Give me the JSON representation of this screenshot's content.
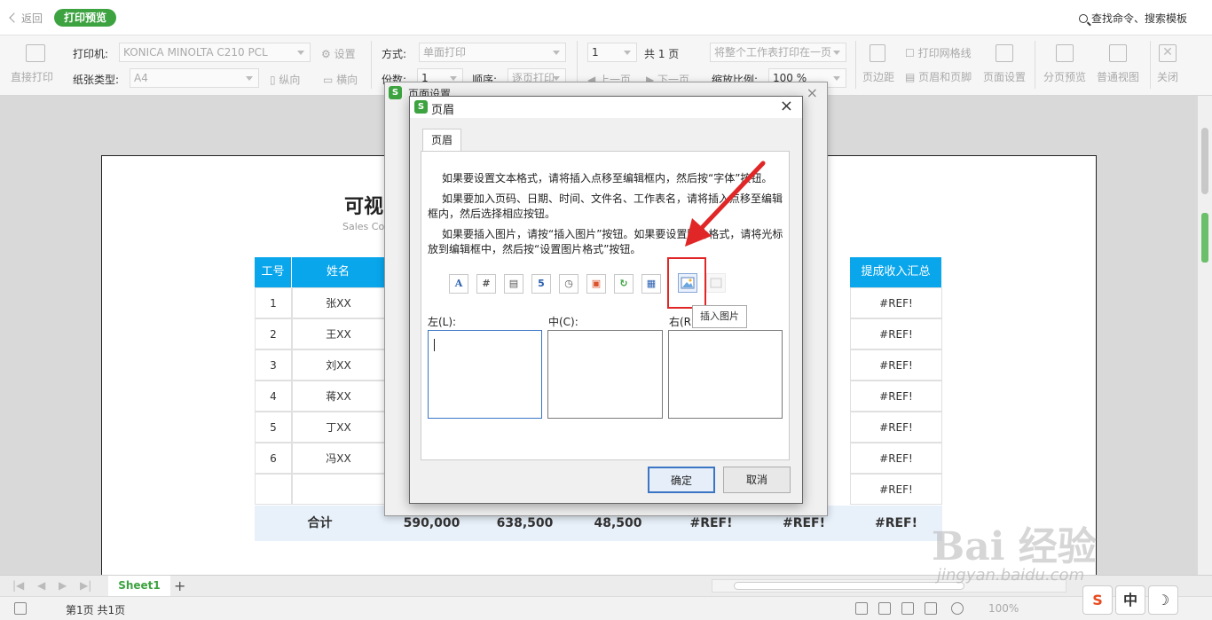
{
  "topbar": {
    "back_label": "返回",
    "mode_label": "打印预览",
    "search_label": "查找命令、搜索模板"
  },
  "toolbar": {
    "direct_print_label": "直接打印",
    "printer_label": "打印机:",
    "printer_value": "KONICA MINOLTA C210 PCL",
    "settings_label": "设置",
    "paper_type_label": "纸张类型:",
    "paper_value": "A4",
    "portrait_label": "纵向",
    "landscape_label": "横向",
    "method_label": "方式:",
    "method_value": "单面打印",
    "copies_label": "份数:",
    "copies_value": "1",
    "order_label": "顺序:",
    "order_value": "逐页打印",
    "page_input": "1",
    "total_pages": "共 1 页",
    "prev_label": "上一页",
    "next_label": "下一页",
    "fit_value": "将整个工作表打印在一页",
    "scale_label": "缩放比例:",
    "scale_value": "100 %",
    "margins_label": "页边距",
    "gridlines_label": "打印网格线",
    "header_footer_label": "页眉和页脚",
    "page_setup_label": "页面设置",
    "page_break_label": "分页预览",
    "normal_view_label": "普通视图",
    "close_label": "关闭"
  },
  "document": {
    "title_partial": "可视",
    "subtitle_partial": "Sales Co",
    "headers": {
      "left": "工号",
      "name": "姓名",
      "right": "提成收入汇总"
    },
    "rows": [
      {
        "id": "1",
        "name": "张XX",
        "total": "#REF!"
      },
      {
        "id": "2",
        "name": "王XX",
        "total": "#REF!"
      },
      {
        "id": "3",
        "name": "刘XX",
        "total": "#REF!"
      },
      {
        "id": "4",
        "name": "蒋XX",
        "total": "#REF!"
      },
      {
        "id": "5",
        "name": "丁XX",
        "total": "#REF!"
      },
      {
        "id": "6",
        "name": "冯XX",
        "total": "#REF!"
      },
      {
        "id": "",
        "name": "",
        "total": "#REF!"
      }
    ],
    "sum_row": [
      "合计",
      "590,000",
      "638,500",
      "48,500",
      "#REF!",
      "#REF!",
      "#REF!"
    ]
  },
  "sheetbar": {
    "sheet_name": "Sheet1",
    "add_label": "+"
  },
  "status": {
    "page_info": "第1页 共1页",
    "zoom": "100%"
  },
  "ime": {
    "brand": "S",
    "lang": "中",
    "moon": "☽"
  },
  "watermark": {
    "text": "Bai 经验",
    "url": "jingyan.baidu.com"
  },
  "dialog_back": {
    "title": "页面设置",
    "close": "×"
  },
  "dialog": {
    "title": "页眉",
    "close": "×",
    "tab": "页眉",
    "para1": "如果要设置文本格式，请将插入点移至编辑框内，然后按“字体”按钮。",
    "para2": "如果要加入页码、日期、时间、文件名、工作表名，请将插入点移至编辑框内，然后选择相应按钮。",
    "para3": "如果要插入图片，请按“插入图片”按钮。如果要设置图片格式，请将光标放到编辑框中，然后按“设置图片格式”按钮。",
    "left_label": "左(L):",
    "center_label": "中(C):",
    "right_label": "右(R):",
    "tooltip": "插入图片",
    "ok": "确定",
    "cancel": "取消",
    "icons": [
      "A",
      "#",
      "▤",
      "5",
      "◷",
      "▣",
      "↻",
      "▦"
    ]
  },
  "colors": {
    "accent": "#3da340",
    "table_header": "#09a6ec",
    "highlight": "#e02626"
  }
}
